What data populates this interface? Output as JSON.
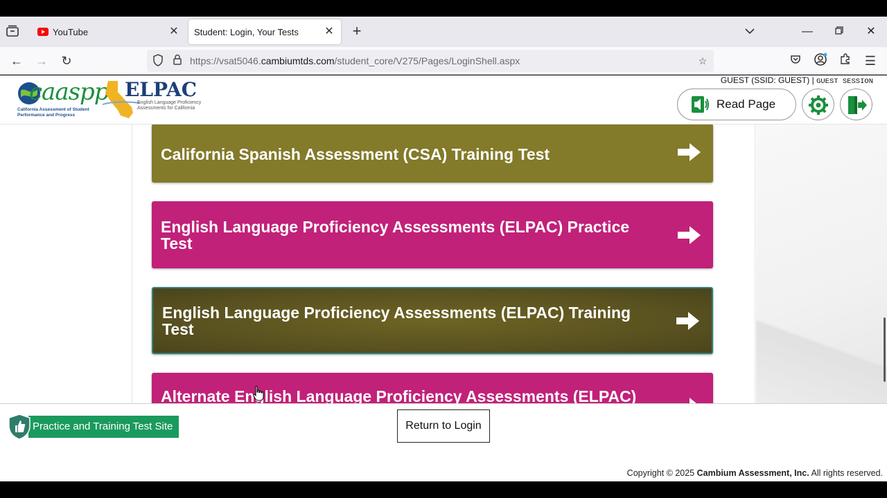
{
  "browser": {
    "tabs": [
      {
        "label": "YouTube",
        "icon": "youtube-icon"
      },
      {
        "label": "Student: Login, Your Tests",
        "active": true
      }
    ],
    "url_prefix": "https://vsat5046.",
    "url_domain": "cambiumtds.com",
    "url_path": "/student_core/V275/Pages/LoginShell.aspx"
  },
  "header": {
    "caaspp_logo_text": "caaspp",
    "caaspp_subtitle": "California Assessment of Student Performance and Progress",
    "elpac_logo_text": "ELPAC",
    "elpac_subtitle": "English Language Proficiency Assessments for California",
    "guest_info": "GUEST (SSID: GUEST)",
    "guest_separator": " | ",
    "guest_session": "GUEST SESSION",
    "read_page_label": "Read Page"
  },
  "tests": [
    {
      "label": "California Spanish Assessment (CSA) Training Test",
      "color": "#837a2a"
    },
    {
      "label": "English Language Proficiency Assessments (ELPAC) Practice Test",
      "color": "#c12179"
    },
    {
      "label": "English Language Proficiency Assessments (ELPAC) Training Test",
      "color": "#5a5220",
      "focused": true
    },
    {
      "label": "Alternate English Language Proficiency Assessments (ELPAC)",
      "color": "#c12179"
    }
  ],
  "footer": {
    "site_badge": "Practice and Training Test Site",
    "return_button": "Return to Login",
    "copyright_prefix": "Copyright © 2025 ",
    "copyright_company": "Cambium Assessment, Inc.",
    "copyright_suffix": " All rights reserved."
  },
  "colors": {
    "accent_green": "#1a9a5c",
    "olive": "#837a2a",
    "magenta": "#c12179"
  }
}
